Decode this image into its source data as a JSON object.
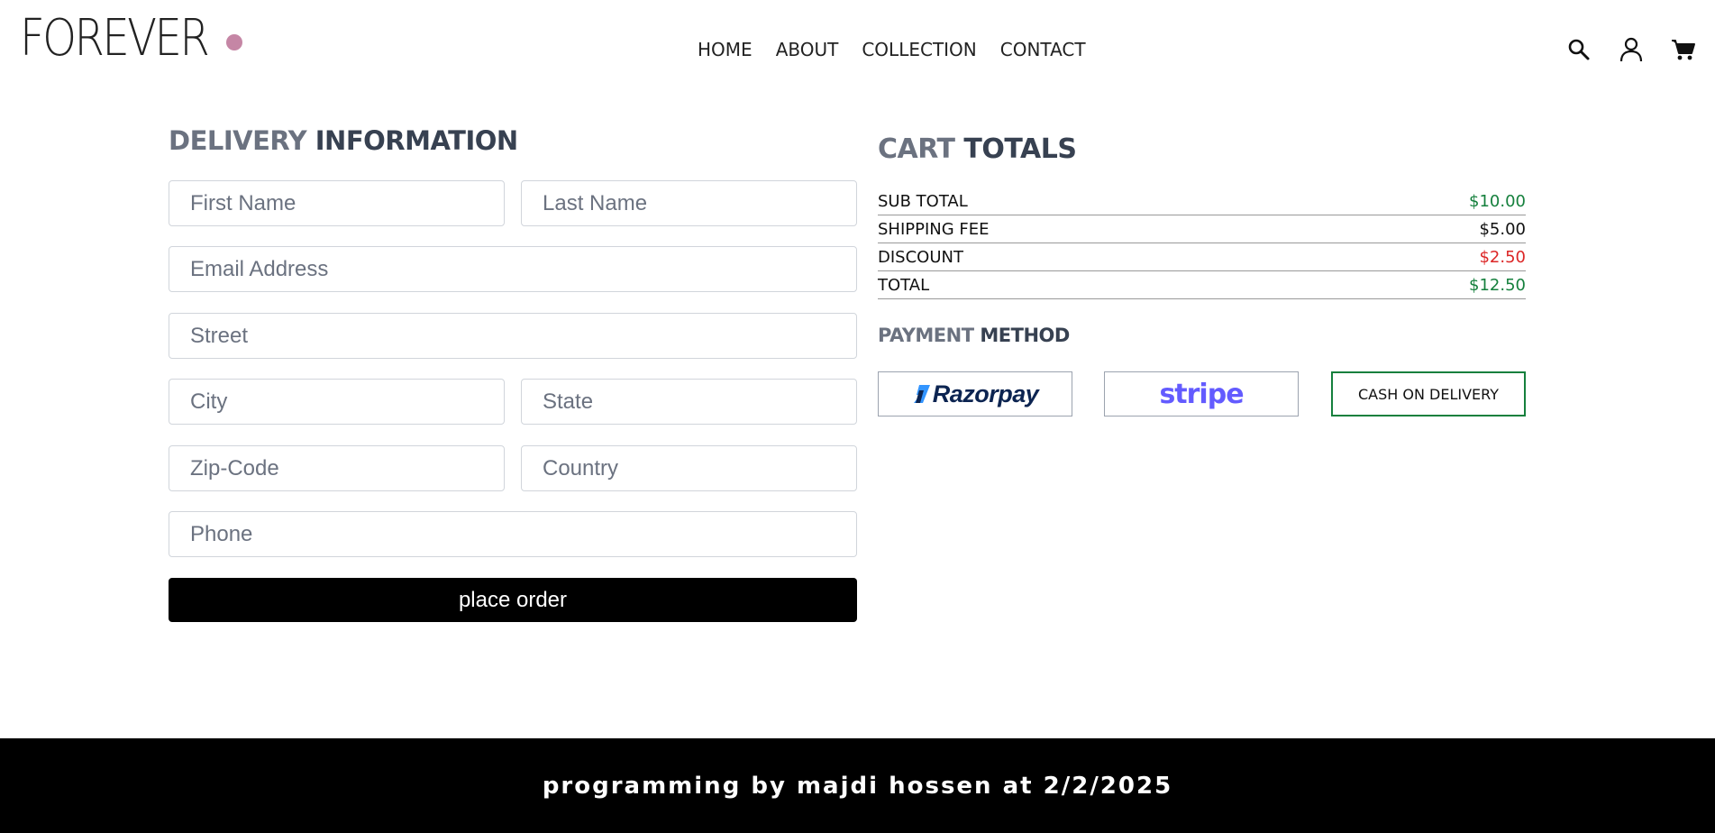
{
  "header": {
    "logo_text": "FOREVER",
    "logo_dot_color": "#c586a5",
    "nav": [
      "HOME",
      "ABOUT",
      "COLLECTION",
      "CONTACT"
    ],
    "icons": [
      "search-icon",
      "profile-icon",
      "cart-icon"
    ]
  },
  "delivery": {
    "title_light": "DELIVERY",
    "title_dark": "INFORMATION",
    "fields": {
      "first_name": "First Name",
      "last_name": "Last Name",
      "email": "Email Address",
      "street": "Street",
      "city": "City",
      "state": "State",
      "zip": "Zip-Code",
      "country": "Country",
      "phone": "Phone"
    },
    "place_order_label": "place order"
  },
  "cart": {
    "title_light": "CART",
    "title_dark": "TOTALS",
    "rows": [
      {
        "label": "SUB TOTAL",
        "value": "$10.00",
        "color": "#15803d"
      },
      {
        "label": "SHIPPING FEE",
        "value": "$5.00",
        "color": "#111111"
      },
      {
        "label": "DISCOUNT",
        "value": "$2.50",
        "color": "#dc2626"
      },
      {
        "label": "TOTAL",
        "value": "$12.50",
        "color": "#15803d"
      }
    ]
  },
  "payment": {
    "title_light": "PAYMENT",
    "title_dark": "METHOD",
    "razorpay_label": "Razorpay",
    "stripe_label": "stripe",
    "cod_label": "CASH ON DELIVERY",
    "selected": "cod",
    "selected_color": "#15803d"
  },
  "footer": {
    "text": "programming by majdi hossen at 2/2/2025"
  }
}
